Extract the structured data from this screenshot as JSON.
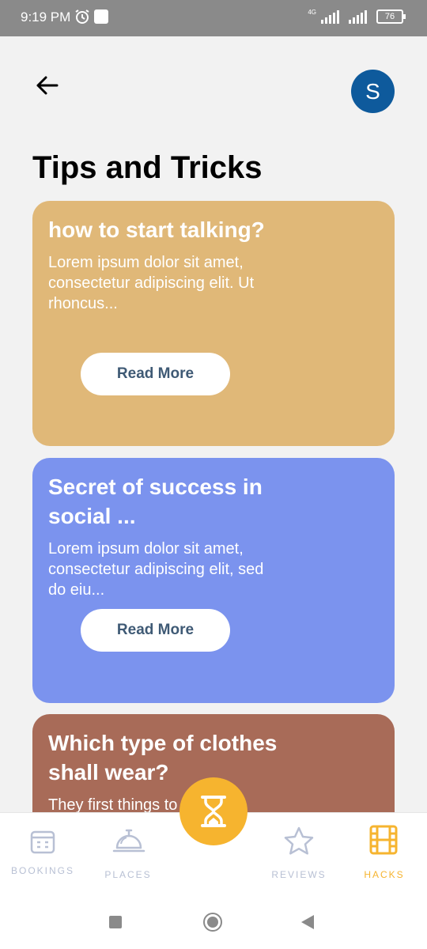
{
  "status": {
    "time": "9:19 PM",
    "network": "4G",
    "battery": "76"
  },
  "header": {
    "avatar_initial": "S",
    "title": "Tips and Tricks"
  },
  "cards": [
    {
      "title": "how to start talking?",
      "description": "Lorem ipsum dolor sit amet, consectetur adipiscing elit. Ut rhoncus...",
      "button": "Read More",
      "color": "#e0b878"
    },
    {
      "title": "Secret of success in social ...",
      "description": "Lorem ipsum dolor sit amet, consectetur adipiscing elit, sed do eiu...",
      "button": "Read More",
      "color": "#7b93ee"
    },
    {
      "title": "Which type of clothes shall wear?",
      "description": "They first things to ce",
      "color": "#a86b58"
    }
  ],
  "nav": {
    "items": [
      {
        "label": "BOOKINGS",
        "icon": "calendar-icon"
      },
      {
        "label": "PLACES",
        "icon": "service-bell-icon"
      },
      {
        "label": "REVIEWS",
        "icon": "star-icon"
      },
      {
        "label": "HACKS",
        "icon": "film-icon",
        "active": true
      }
    ],
    "fab_icon": "hourglass-icon",
    "active_color": "#f6b42f",
    "inactive_color": "#b8c0d4"
  }
}
